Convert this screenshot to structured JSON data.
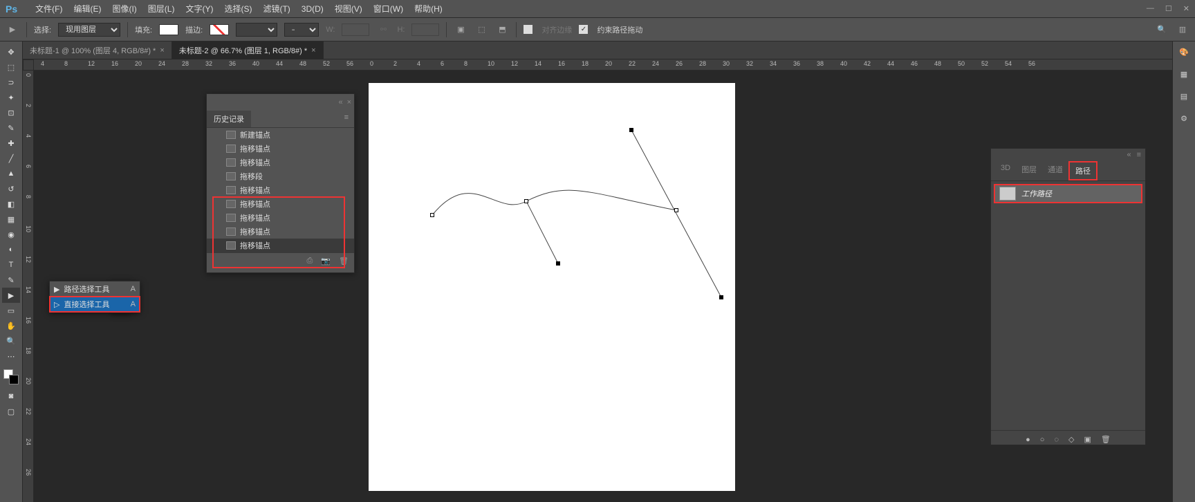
{
  "menubar": {
    "items": [
      "文件(F)",
      "编辑(E)",
      "图像(I)",
      "图层(L)",
      "文字(Y)",
      "选择(S)",
      "滤镜(T)",
      "3D(D)",
      "视图(V)",
      "窗口(W)",
      "帮助(H)"
    ]
  },
  "optbar": {
    "select_label": "选择:",
    "select_value": "现用图层",
    "fill_label": "填充:",
    "stroke_label": "描边:",
    "w_label": "W:",
    "h_label": "H:",
    "align_label": "对齐边缘",
    "constrain_label": "约束路径拖动"
  },
  "tabs": [
    {
      "title": "未标题-1 @ 100% (图层 4, RGB/8#) *",
      "active": false
    },
    {
      "title": "未标题-2 @ 66.7% (图层 1, RGB/8#) *",
      "active": true
    }
  ],
  "ruler_h": [
    "4",
    "8",
    "12",
    "16",
    "20",
    "24",
    "28",
    "32",
    "36",
    "40",
    "44",
    "48",
    "52",
    "56",
    "0",
    "2",
    "4",
    "6",
    "8",
    "10",
    "12",
    "14",
    "16",
    "18",
    "20",
    "22",
    "24",
    "26",
    "28",
    "30",
    "32",
    "34",
    "36",
    "38",
    "40",
    "42",
    "44",
    "46",
    "48",
    "50",
    "52",
    "54",
    "56"
  ],
  "ruler_v": [
    "0",
    "2",
    "4",
    "6",
    "8",
    "10",
    "12",
    "14",
    "16",
    "18",
    "20",
    "22",
    "24",
    "26"
  ],
  "flyout": {
    "items": [
      {
        "icon": "▶",
        "label": "路径选择工具",
        "shortcut": "A"
      },
      {
        "icon": "▷",
        "label": "直接选择工具",
        "shortcut": "A"
      }
    ]
  },
  "history": {
    "title": "历史记录",
    "items": [
      "新建锚点",
      "拖移锚点",
      "拖移锚点",
      "拖移段",
      "拖移锚点",
      "拖移锚点",
      "拖移锚点",
      "拖移锚点",
      "拖移锚点"
    ]
  },
  "paths_panel": {
    "tabs": [
      "3D",
      "图层",
      "通道",
      "路径"
    ],
    "active_tab": 3,
    "item": "工作路径"
  }
}
